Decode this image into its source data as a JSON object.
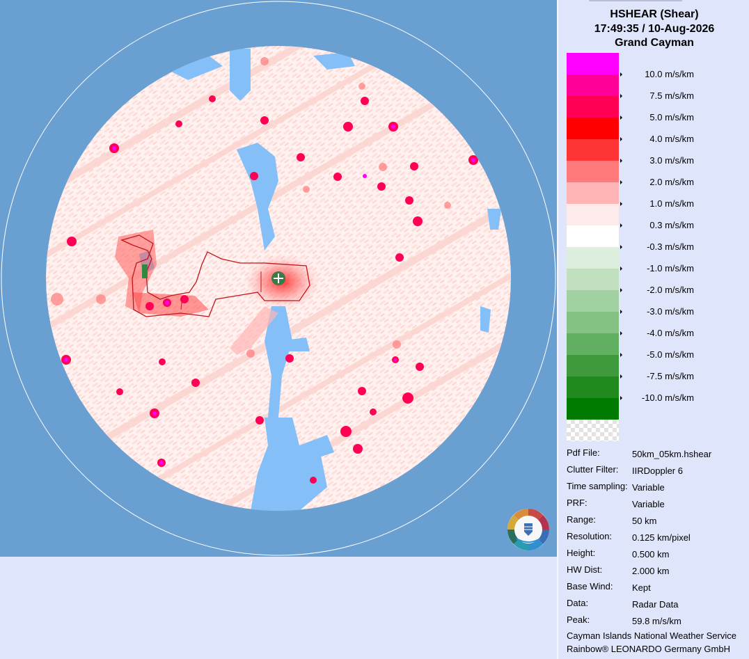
{
  "header": {
    "product": "HSHEAR (Shear)",
    "datetime": "17:49:35 / 10-Aug-2026",
    "site": "Grand Cayman"
  },
  "legend": {
    "colors": [
      "#ff00ff",
      "#ff0099",
      "#ff0055",
      "#ff0000",
      "#ff3535",
      "#ff7a7a",
      "#ffb5b5",
      "#fdeaea",
      "#ffffff",
      "#deeedd",
      "#c1e0c0",
      "#a2d1a1",
      "#83c282",
      "#61af60",
      "#3f9a3e",
      "#208a1f",
      "#007b00"
    ],
    "thresholds": [
      "10.0 m/s/km",
      "7.5 m/s/km",
      "5.0 m/s/km",
      "4.0 m/s/km",
      "3.0 m/s/km",
      "2.0 m/s/km",
      "1.0 m/s/km",
      "0.3 m/s/km",
      "-0.3 m/s/km",
      "-1.0 m/s/km",
      "-2.0 m/s/km",
      "-3.0 m/s/km",
      "-4.0 m/s/km",
      "-5.0 m/s/km",
      "-7.5 m/s/km",
      "-10.0 m/s/km"
    ]
  },
  "info": [
    {
      "label": "Pdf File:",
      "value": "50km_05km.hshear"
    },
    {
      "label": "Clutter Filter:",
      "value": "IIRDoppler 6"
    },
    {
      "label": "Time sampling:",
      "value": "Variable"
    },
    {
      "label": "PRF:",
      "value": "Variable"
    },
    {
      "label": "Range:",
      "value": "50 km"
    },
    {
      "label": "Resolution:",
      "value": "0.125 km/pixel"
    },
    {
      "label": "Height:",
      "value": "0.500 km"
    },
    {
      "label": "HW Dist:",
      "value": "2.000 km"
    },
    {
      "label": "Base Wind:",
      "value": "Kept"
    },
    {
      "label": "Data:",
      "value": "Radar Data"
    },
    {
      "label": "Peak:",
      "value": "59.8 m/s/km"
    }
  ],
  "credits": {
    "agency": "Cayman Islands National Weather Service",
    "software": "Rainbow® LEONARDO Germany GmbH"
  },
  "map": {
    "background_color": "#6a9fd2",
    "nodata_color": "#84c0f7",
    "site_marker_color": "#3d7a47",
    "coastline_color": "#c0161c"
  }
}
